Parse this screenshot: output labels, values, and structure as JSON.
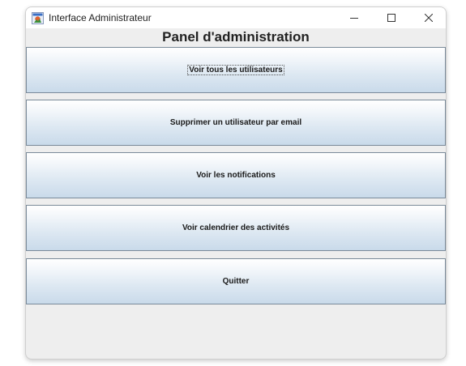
{
  "window": {
    "title": "Interface Administrateur",
    "icon": "java-app-icon",
    "controls": {
      "minimize": "minimize-icon",
      "maximize": "maximize-icon",
      "close": "close-icon"
    }
  },
  "panel": {
    "title": "Panel d'administration"
  },
  "buttons": [
    {
      "label": "Voir tous les utilisateurs",
      "focused": true
    },
    {
      "label": "Supprimer un utilisateur par email",
      "focused": false
    },
    {
      "label": "Voir les notifications",
      "focused": false
    },
    {
      "label": "Voir calendrier des activités",
      "focused": false
    },
    {
      "label": "Quitter",
      "focused": false
    }
  ],
  "colors": {
    "button_gradient_top": "#ffffff",
    "button_gradient_bottom": "#c9daea",
    "button_border": "#7a8a99",
    "window_background": "#eeeeee"
  }
}
